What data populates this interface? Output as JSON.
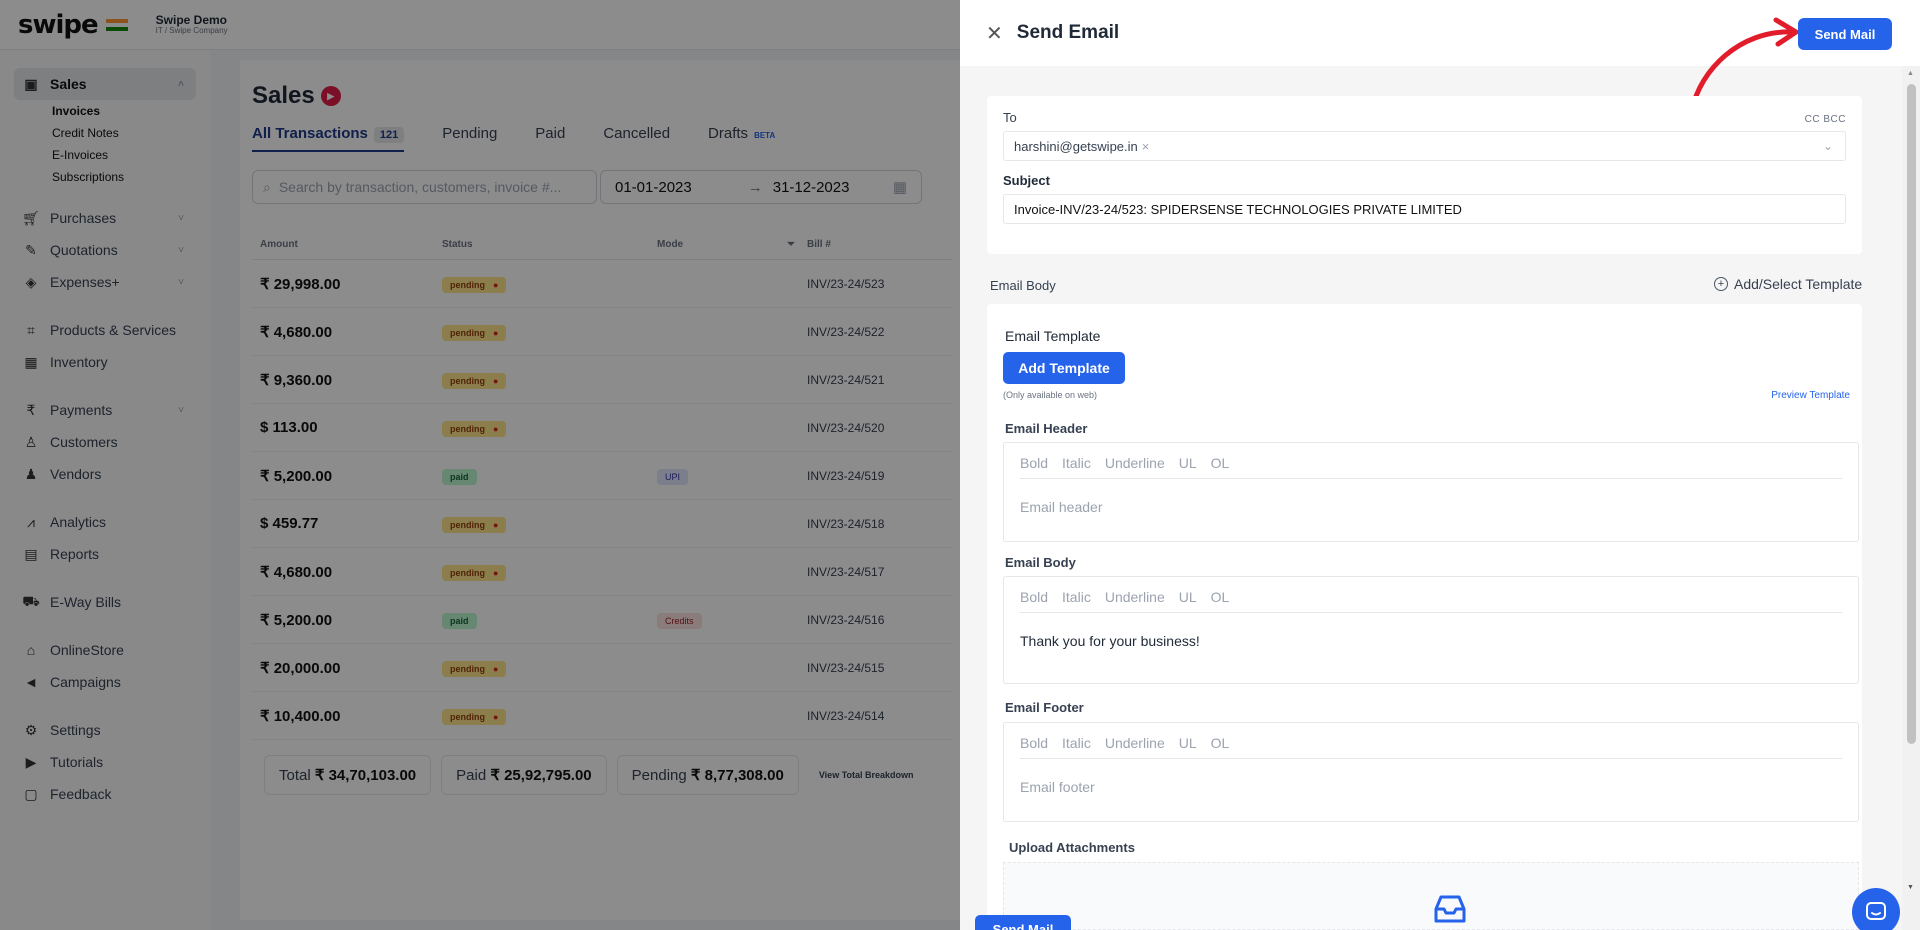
{
  "app": {
    "logo": "swipe",
    "company_name": "Swipe Demo",
    "company_sub": "IT / Swipe Company"
  },
  "sidebar": {
    "sales": "Sales",
    "sales_sub": [
      "Invoices",
      "Credit Notes",
      "E-Invoices",
      "Subscriptions"
    ],
    "items": [
      {
        "label": "Purchases",
        "icon": "cart-icon"
      },
      {
        "label": "Quotations",
        "icon": "pen-icon"
      },
      {
        "label": "Expenses+",
        "icon": "tag-icon"
      },
      {
        "label": "Products & Services",
        "icon": "box-icon"
      },
      {
        "label": "Inventory",
        "icon": "inventory-icon"
      },
      {
        "label": "Payments",
        "icon": "rupee-icon"
      },
      {
        "label": "Customers",
        "icon": "user-icon"
      },
      {
        "label": "Vendors",
        "icon": "users-icon"
      },
      {
        "label": "Analytics",
        "icon": "chart-icon"
      },
      {
        "label": "Reports",
        "icon": "report-icon"
      },
      {
        "label": "E-Way Bills",
        "icon": "truck-icon"
      },
      {
        "label": "OnlineStore",
        "icon": "store-icon"
      },
      {
        "label": "Campaigns",
        "icon": "megaphone-icon"
      },
      {
        "label": "Settings",
        "icon": "gear-icon"
      },
      {
        "label": "Tutorials",
        "icon": "youtube-icon"
      },
      {
        "label": "Feedback",
        "icon": "chat-icon"
      }
    ]
  },
  "main": {
    "title": "Sales",
    "tabs": [
      {
        "label": "All Transactions",
        "count": "121"
      },
      {
        "label": "Pending"
      },
      {
        "label": "Paid"
      },
      {
        "label": "Cancelled"
      },
      {
        "label": "Drafts",
        "badge": "BETA"
      }
    ],
    "search_placeholder": "Search by transaction, customers, invoice #...",
    "date_from": "01-01-2023",
    "date_to": "31-12-2023",
    "columns": [
      "Amount",
      "Status",
      "Mode",
      "Bill #"
    ],
    "rows": [
      {
        "amount": "₹ 29,998.00",
        "status": "pending",
        "mode": "",
        "bill": "INV/23-24/523"
      },
      {
        "amount": "₹ 4,680.00",
        "status": "pending",
        "mode": "",
        "bill": "INV/23-24/522"
      },
      {
        "amount": "₹ 9,360.00",
        "status": "pending",
        "mode": "",
        "bill": "INV/23-24/521"
      },
      {
        "amount": "$ 113.00",
        "status": "pending",
        "mode": "",
        "bill": "INV/23-24/520"
      },
      {
        "amount": "₹ 5,200.00",
        "status": "paid",
        "mode": "UPI",
        "bill": "INV/23-24/519"
      },
      {
        "amount": "$ 459.77",
        "status": "pending",
        "mode": "",
        "bill": "INV/23-24/518"
      },
      {
        "amount": "₹ 4,680.00",
        "status": "pending",
        "mode": "",
        "bill": "INV/23-24/517"
      },
      {
        "amount": "₹ 5,200.00",
        "status": "paid",
        "mode": "Credits",
        "bill": "INV/23-24/516"
      },
      {
        "amount": "₹ 20,000.00",
        "status": "pending",
        "mode": "",
        "bill": "INV/23-24/515"
      },
      {
        "amount": "₹ 10,400.00",
        "status": "pending",
        "mode": "",
        "bill": "INV/23-24/514"
      }
    ],
    "total_label": "Total",
    "total_value": "₹ 34,70,103.00",
    "paid_label": "Paid",
    "paid_value": "₹ 25,92,795.00",
    "pending_label": "Pending",
    "pending_value": "₹ 8,77,308.00",
    "breakdown_link": "View Total Breakdown"
  },
  "drawer": {
    "title": "Send Email",
    "send_label": "Send Mail",
    "to_label": "To",
    "cc_bcc": "CC BCC",
    "to_value": "harshini@getswipe.in",
    "subject_label": "Subject",
    "subject_value": "Invoice-INV/23-24/523: SPIDERSENSE TECHNOLOGIES PRIVATE LIMITED",
    "email_body_label": "Email Body",
    "add_select_template": "Add/Select Template",
    "email_template_label": "Email Template",
    "add_template_button": "Add Template",
    "only_web": "(Only available on web)",
    "preview_template": "Preview Template",
    "toolbar": [
      "Bold",
      "Italic",
      "Underline",
      "UL",
      "OL"
    ],
    "header_label": "Email Header",
    "header_placeholder": "Email header",
    "body_label": "Email Body",
    "body_value": "Thank you for your business!",
    "footer_label": "Email Footer",
    "footer_placeholder": "Email footer",
    "upload_label": "Upload Attachments"
  },
  "colors": {
    "primary": "#2563eb",
    "annotation_arrow": "#e11d2b"
  }
}
